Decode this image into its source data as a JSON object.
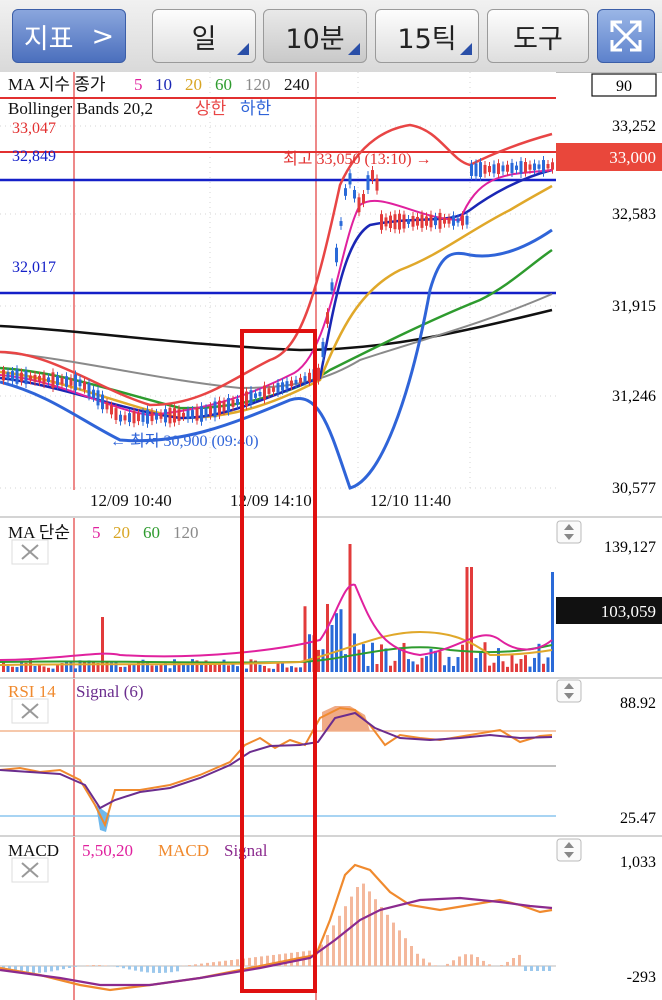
{
  "toolbar": {
    "indicator_label": "지표",
    "indicator_arrow": ">",
    "daily_label": "일",
    "interval_label": "10분",
    "tick_label": "15틱",
    "tools_label": "도구",
    "expand_icon": "expand-icon"
  },
  "main_panel": {
    "legend_ma_title": "MA 지수 종가",
    "ma_periods": [
      "5",
      "10",
      "20",
      "60",
      "120",
      "240"
    ],
    "ma_colors": [
      "#e0219e",
      "#1a27b5",
      "#d8a523",
      "#2e9b2e",
      "#8a8a8a",
      "#111111"
    ],
    "bb_title": "Bollinger Bands 20,2",
    "bb_upper": "상한",
    "bb_lower": "하한",
    "price_box": "90",
    "levels": {
      "level_33047": "33,047",
      "level_32849": "32,849",
      "level_32017": "32,017"
    },
    "axis_labels": [
      "33,252",
      "32,583",
      "31,915",
      "31,246",
      "30,577"
    ],
    "current_price": "33,000",
    "high_annotation": "최고 33,050 (13:10) →",
    "low_annotation": "← 최저 30,900 (09:40)",
    "time_labels": [
      "12/09 10:40",
      "12/09 14:10",
      "12/10 11:40"
    ]
  },
  "volume_panel": {
    "title": "MA 단순",
    "ma_periods": [
      "5",
      "20",
      "60",
      "120"
    ],
    "axis_top": "139,127",
    "current_value": "103,059"
  },
  "rsi_panel": {
    "title": "RSI 14",
    "signal": "Signal (6)",
    "axis_top": "88.92",
    "axis_bottom": "25.47"
  },
  "macd_panel": {
    "title": "MACD",
    "params": "5,50,20",
    "macd_label": "MACD",
    "signal_label": "Signal",
    "axis_top": "1,033",
    "axis_bottom": "-293"
  }
}
